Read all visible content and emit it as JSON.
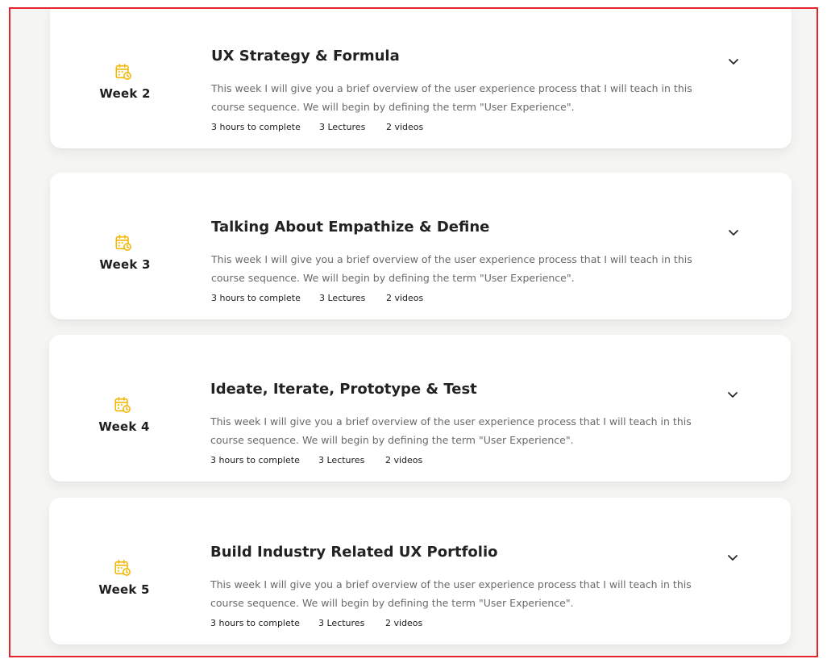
{
  "colors": {
    "accent": "#f2b705",
    "frame_border": "#e2262b",
    "page_background": "#f5f6f3",
    "card_background": "#ffffff"
  },
  "icons": {
    "week": "calendar-clock-icon",
    "toggle": "chevron-down-icon"
  },
  "weeks": [
    {
      "week_label": "Week 2",
      "title": "UX Strategy & Formula",
      "description": "This week I will give you a brief overview of the user experience process that I will teach in this course sequence. We will begin by defining the term \"User Experience\".",
      "hours": "3 hours to complete",
      "lectures": "3 Lectures",
      "videos": "2 videos"
    },
    {
      "week_label": "Week 3",
      "title": "Talking About Empathize & Define",
      "description": "This week I will give you a brief overview of the user experience process that I will teach in this course sequence. We will begin by defining the term \"User Experience\".",
      "hours": "3 hours to complete",
      "lectures": "3 Lectures",
      "videos": "2 videos"
    },
    {
      "week_label": "Week 4",
      "title": "Ideate, Iterate, Prototype & Test",
      "description": "This week I will give you a brief overview of the user experience process that I will teach in this course sequence. We will begin by defining the term \"User Experience\".",
      "hours": "3 hours to complete",
      "lectures": "3 Lectures",
      "videos": "2 videos"
    },
    {
      "week_label": "Week 5",
      "title": "Build Industry Related UX Portfolio",
      "description": "This week I will give you a brief overview of the user experience process that I will teach in this course sequence. We will begin by defining the term \"User Experience\".",
      "hours": "3 hours to complete",
      "lectures": "3 Lectures",
      "videos": "2 videos"
    }
  ]
}
